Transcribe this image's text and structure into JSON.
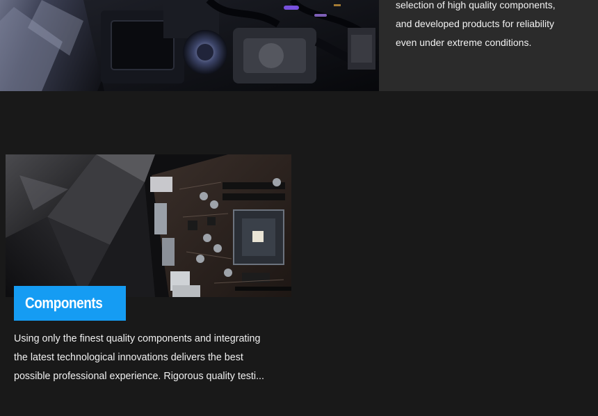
{
  "hero": {
    "text_lines": [
      "selection of high quality components,",
      "and developed products for reliability",
      "even under extreme conditions."
    ]
  },
  "card": {
    "title": "Components",
    "description_lines": [
      "Using only the finest quality components and integrating",
      "the latest technological innovations delivers the best",
      "possible professional experience. Rigorous quality testi..."
    ]
  },
  "colors": {
    "page_background": "#191919",
    "hero_band_background": "#2b2b2b",
    "badge_accent": "#159cf3",
    "text": "#f0f0f0"
  }
}
